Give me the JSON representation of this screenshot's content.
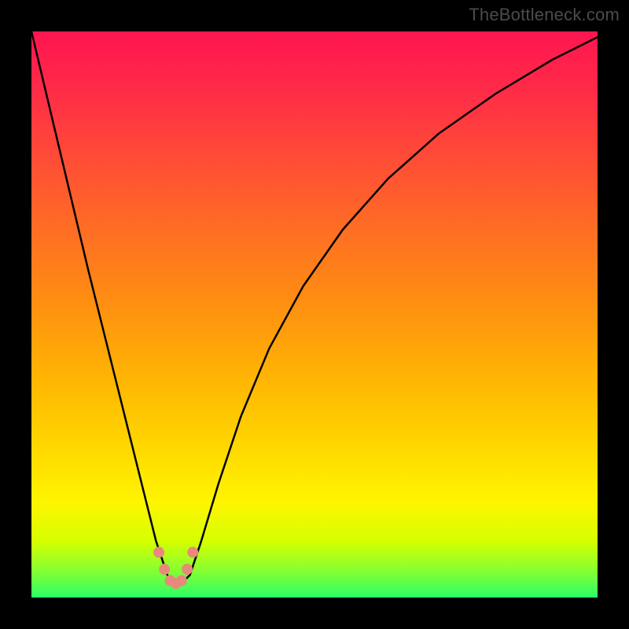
{
  "watermark": "TheBottleneck.com",
  "chart_data": {
    "type": "line",
    "title": "",
    "xlabel": "",
    "ylabel": "",
    "xlim": [
      0,
      100
    ],
    "ylim": [
      0,
      100
    ],
    "grid": false,
    "legend": false,
    "series": [
      {
        "name": "curve",
        "color": "#000000",
        "x": [
          0,
          5,
          10,
          15,
          20,
          22,
          24,
          25,
          26,
          28,
          30,
          33,
          37,
          42,
          48,
          55,
          63,
          72,
          82,
          92,
          100
        ],
        "values": [
          100,
          79,
          58,
          38,
          18,
          10,
          4,
          2,
          2,
          4,
          10,
          20,
          32,
          44,
          55,
          65,
          74,
          82,
          89,
          95,
          99
        ]
      }
    ],
    "markers": {
      "name": "dots-near-trough",
      "color": "#e88a7a",
      "points": [
        {
          "x": 22.5,
          "y": 8
        },
        {
          "x": 23.5,
          "y": 5
        },
        {
          "x": 24.5,
          "y": 3
        },
        {
          "x": 25.5,
          "y": 2.5
        },
        {
          "x": 26.5,
          "y": 3
        },
        {
          "x": 27.5,
          "y": 5
        },
        {
          "x": 28.5,
          "y": 8
        }
      ]
    },
    "background_gradient": {
      "top": "#ff1550",
      "mid": "#ffd300",
      "bottom": "#2aff68"
    }
  }
}
